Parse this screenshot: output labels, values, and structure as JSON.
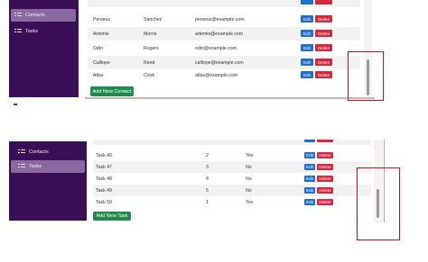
{
  "top": {
    "sidebar": {
      "items": [
        {
          "label": "Contacts",
          "active": true
        },
        {
          "label": "Tasks",
          "active": false
        }
      ]
    },
    "rows": [
      {
        "first": "Perseus",
        "last": "Sanchez",
        "email": "perseus@example.com"
      },
      {
        "first": "Artemis",
        "last": "Morris",
        "email": "artemis@example.com"
      },
      {
        "first": "Odin",
        "last": "Rogers",
        "email": "odin@example.com"
      },
      {
        "first": "Calliope",
        "last": "Reed",
        "email": "calliope@example.com"
      },
      {
        "first": "Atlas",
        "last": "Cook",
        "email": "atlas@example.com"
      }
    ],
    "edit_label": "Edit",
    "delete_label": "Delete",
    "add_label": "Add New Contact"
  },
  "bottom": {
    "sidebar": {
      "items": [
        {
          "label": "Contacts",
          "active": false
        },
        {
          "label": "Tasks",
          "active": true
        }
      ]
    },
    "rows": [
      {
        "title": "Task 46",
        "priority": "2",
        "done": "Yes"
      },
      {
        "title": "Task 47",
        "priority": "3",
        "done": "No"
      },
      {
        "title": "Task 48",
        "priority": "4",
        "done": "No"
      },
      {
        "title": "Task 49",
        "priority": "5",
        "done": "No"
      },
      {
        "title": "Task 50",
        "priority": "1",
        "done": "Yes"
      }
    ],
    "edit_label": "Edit",
    "delete_label": "Delete",
    "add_label": "Add New Task"
  },
  "colors": {
    "sidebar": "#3b0f57",
    "edit": "#1f6fd1",
    "delete": "#d7263d",
    "add": "#1f8a4c",
    "highlight": "#d01010"
  }
}
